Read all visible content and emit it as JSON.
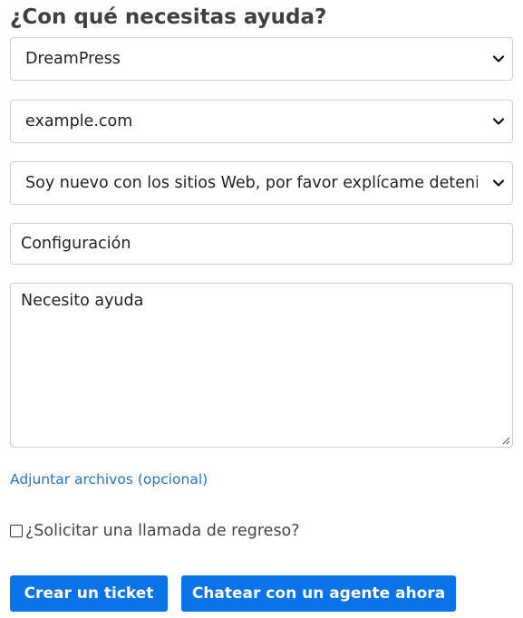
{
  "form": {
    "title": "¿Con qué necesitas ayuda?",
    "product_select": {
      "value": "DreamPress"
    },
    "domain_select": {
      "value": "example.com"
    },
    "experience_select": {
      "value": "Soy nuevo con los sitios Web, por favor explícame detenic"
    },
    "subject_input": {
      "value": "Configuración"
    },
    "message_textarea": {
      "value": "Necesito ayuda"
    },
    "attach_link": "Adjuntar archivos (opcional)",
    "callback_label": "¿Solicitar una llamada de regreso?",
    "callback_checked": false,
    "create_ticket_button": "Crear un ticket",
    "chat_button": "Chatear con un agente ahora"
  },
  "icons": {
    "select_arrow": "chevron-down-icon",
    "resize_handle": "resize-grip-icon"
  },
  "colors": {
    "primary_button": "#0a73e8",
    "link": "#1f76d2",
    "title": "#404040",
    "field_border": "#cfcfcf"
  }
}
